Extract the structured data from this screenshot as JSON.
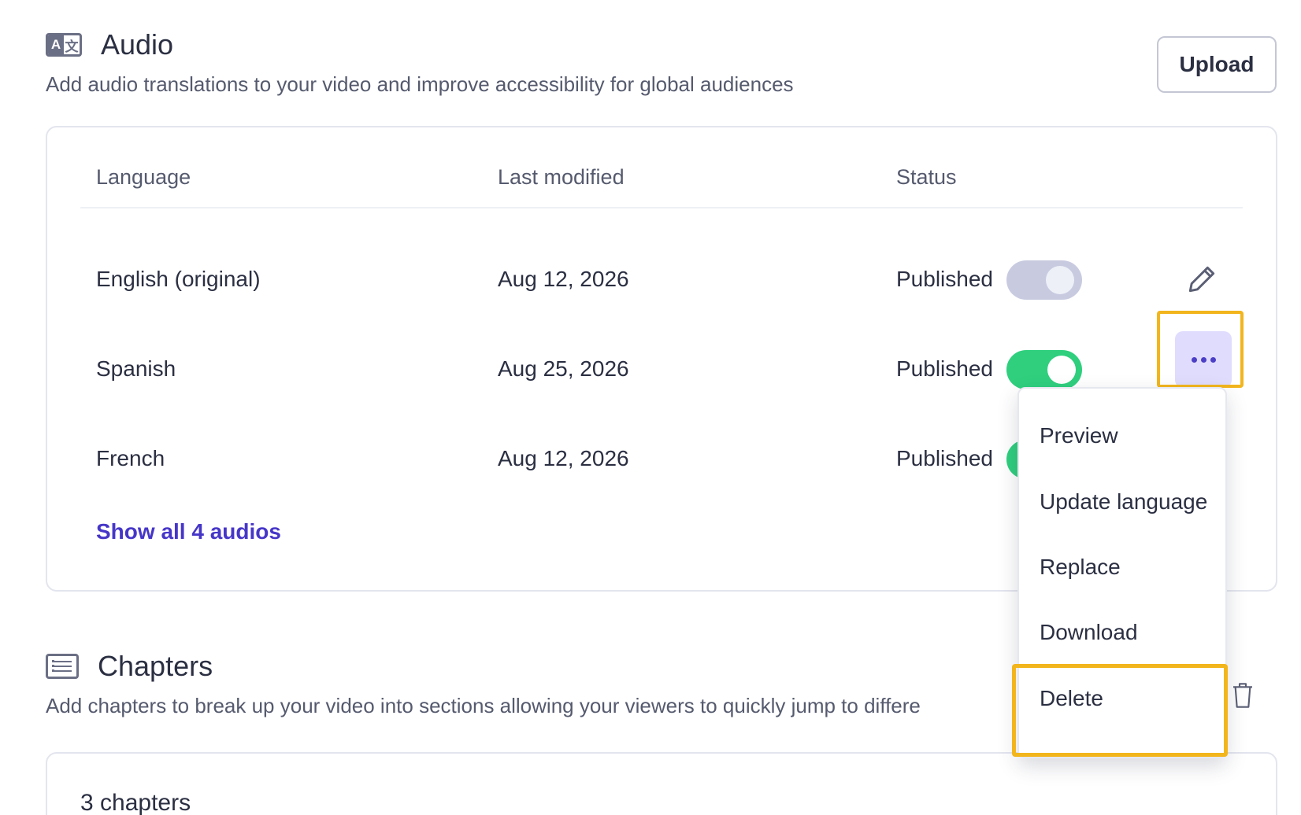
{
  "audio": {
    "title": "Audio",
    "description": "Add audio translations to your video and improve accessibility for global audiences",
    "upload_label": "Upload",
    "icon_letter_a": "A",
    "icon_letter_b": "文",
    "columns": {
      "language": "Language",
      "last_modified": "Last modified",
      "status": "Status"
    },
    "rows": [
      {
        "language": "English (original)",
        "last_modified": "Aug 12, 2026",
        "status": "Published",
        "toggle": "off"
      },
      {
        "language": "Spanish",
        "last_modified": "Aug 25, 2026",
        "status": "Published",
        "toggle": "on"
      },
      {
        "language": "French",
        "last_modified": "Aug 12, 2026",
        "status": "Published",
        "toggle": "on"
      }
    ],
    "show_all_label": "Show all 4 audios"
  },
  "menu": {
    "items": [
      "Preview",
      "Update language",
      "Replace",
      "Download",
      "Delete"
    ]
  },
  "chapters": {
    "title": "Chapters",
    "description": "Add chapters to break up your video into sections allowing your viewers to quickly jump to differe",
    "count_label": "3 chapters"
  },
  "colors": {
    "accent": "#4636c8",
    "toggle_on": "#2fcf7e",
    "toggle_off": "#c8cbe0",
    "highlight": "#f2b51c"
  },
  "icons": {
    "audio_section": "translate-icon",
    "chapters_section": "list-icon",
    "edit": "pencil-icon",
    "more": "more-horizontal-icon",
    "trash": "trash-icon"
  }
}
